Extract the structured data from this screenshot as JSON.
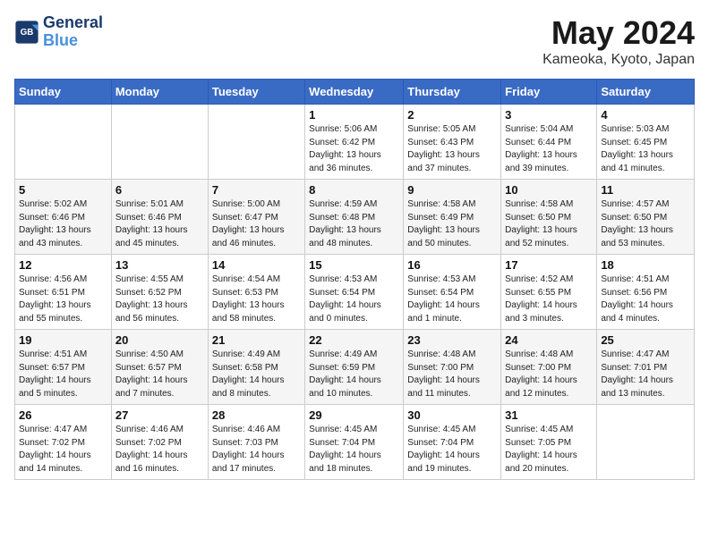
{
  "header": {
    "logo_line1": "General",
    "logo_line2": "Blue",
    "month": "May 2024",
    "location": "Kameoka, Kyoto, Japan"
  },
  "days_of_week": [
    "Sunday",
    "Monday",
    "Tuesday",
    "Wednesday",
    "Thursday",
    "Friday",
    "Saturday"
  ],
  "weeks": [
    [
      {
        "day": "",
        "info": ""
      },
      {
        "day": "",
        "info": ""
      },
      {
        "day": "",
        "info": ""
      },
      {
        "day": "1",
        "info": "Sunrise: 5:06 AM\nSunset: 6:42 PM\nDaylight: 13 hours\nand 36 minutes."
      },
      {
        "day": "2",
        "info": "Sunrise: 5:05 AM\nSunset: 6:43 PM\nDaylight: 13 hours\nand 37 minutes."
      },
      {
        "day": "3",
        "info": "Sunrise: 5:04 AM\nSunset: 6:44 PM\nDaylight: 13 hours\nand 39 minutes."
      },
      {
        "day": "4",
        "info": "Sunrise: 5:03 AM\nSunset: 6:45 PM\nDaylight: 13 hours\nand 41 minutes."
      }
    ],
    [
      {
        "day": "5",
        "info": "Sunrise: 5:02 AM\nSunset: 6:46 PM\nDaylight: 13 hours\nand 43 minutes."
      },
      {
        "day": "6",
        "info": "Sunrise: 5:01 AM\nSunset: 6:46 PM\nDaylight: 13 hours\nand 45 minutes."
      },
      {
        "day": "7",
        "info": "Sunrise: 5:00 AM\nSunset: 6:47 PM\nDaylight: 13 hours\nand 46 minutes."
      },
      {
        "day": "8",
        "info": "Sunrise: 4:59 AM\nSunset: 6:48 PM\nDaylight: 13 hours\nand 48 minutes."
      },
      {
        "day": "9",
        "info": "Sunrise: 4:58 AM\nSunset: 6:49 PM\nDaylight: 13 hours\nand 50 minutes."
      },
      {
        "day": "10",
        "info": "Sunrise: 4:58 AM\nSunset: 6:50 PM\nDaylight: 13 hours\nand 52 minutes."
      },
      {
        "day": "11",
        "info": "Sunrise: 4:57 AM\nSunset: 6:50 PM\nDaylight: 13 hours\nand 53 minutes."
      }
    ],
    [
      {
        "day": "12",
        "info": "Sunrise: 4:56 AM\nSunset: 6:51 PM\nDaylight: 13 hours\nand 55 minutes."
      },
      {
        "day": "13",
        "info": "Sunrise: 4:55 AM\nSunset: 6:52 PM\nDaylight: 13 hours\nand 56 minutes."
      },
      {
        "day": "14",
        "info": "Sunrise: 4:54 AM\nSunset: 6:53 PM\nDaylight: 13 hours\nand 58 minutes."
      },
      {
        "day": "15",
        "info": "Sunrise: 4:53 AM\nSunset: 6:54 PM\nDaylight: 14 hours\nand 0 minutes."
      },
      {
        "day": "16",
        "info": "Sunrise: 4:53 AM\nSunset: 6:54 PM\nDaylight: 14 hours\nand 1 minute."
      },
      {
        "day": "17",
        "info": "Sunrise: 4:52 AM\nSunset: 6:55 PM\nDaylight: 14 hours\nand 3 minutes."
      },
      {
        "day": "18",
        "info": "Sunrise: 4:51 AM\nSunset: 6:56 PM\nDaylight: 14 hours\nand 4 minutes."
      }
    ],
    [
      {
        "day": "19",
        "info": "Sunrise: 4:51 AM\nSunset: 6:57 PM\nDaylight: 14 hours\nand 5 minutes."
      },
      {
        "day": "20",
        "info": "Sunrise: 4:50 AM\nSunset: 6:57 PM\nDaylight: 14 hours\nand 7 minutes."
      },
      {
        "day": "21",
        "info": "Sunrise: 4:49 AM\nSunset: 6:58 PM\nDaylight: 14 hours\nand 8 minutes."
      },
      {
        "day": "22",
        "info": "Sunrise: 4:49 AM\nSunset: 6:59 PM\nDaylight: 14 hours\nand 10 minutes."
      },
      {
        "day": "23",
        "info": "Sunrise: 4:48 AM\nSunset: 7:00 PM\nDaylight: 14 hours\nand 11 minutes."
      },
      {
        "day": "24",
        "info": "Sunrise: 4:48 AM\nSunset: 7:00 PM\nDaylight: 14 hours\nand 12 minutes."
      },
      {
        "day": "25",
        "info": "Sunrise: 4:47 AM\nSunset: 7:01 PM\nDaylight: 14 hours\nand 13 minutes."
      }
    ],
    [
      {
        "day": "26",
        "info": "Sunrise: 4:47 AM\nSunset: 7:02 PM\nDaylight: 14 hours\nand 14 minutes."
      },
      {
        "day": "27",
        "info": "Sunrise: 4:46 AM\nSunset: 7:02 PM\nDaylight: 14 hours\nand 16 minutes."
      },
      {
        "day": "28",
        "info": "Sunrise: 4:46 AM\nSunset: 7:03 PM\nDaylight: 14 hours\nand 17 minutes."
      },
      {
        "day": "29",
        "info": "Sunrise: 4:45 AM\nSunset: 7:04 PM\nDaylight: 14 hours\nand 18 minutes."
      },
      {
        "day": "30",
        "info": "Sunrise: 4:45 AM\nSunset: 7:04 PM\nDaylight: 14 hours\nand 19 minutes."
      },
      {
        "day": "31",
        "info": "Sunrise: 4:45 AM\nSunset: 7:05 PM\nDaylight: 14 hours\nand 20 minutes."
      },
      {
        "day": "",
        "info": ""
      }
    ]
  ]
}
